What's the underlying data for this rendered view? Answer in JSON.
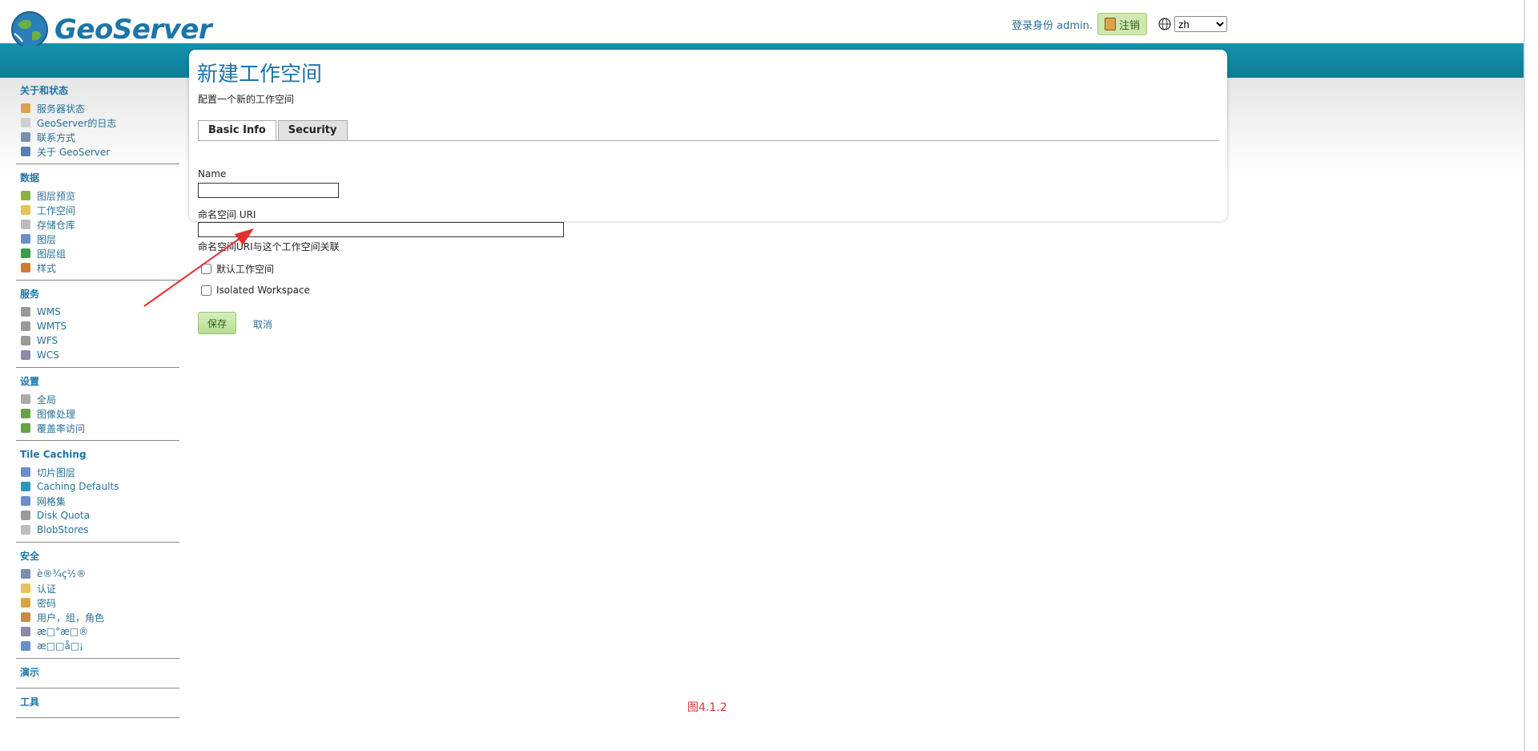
{
  "app": {
    "name": "GeoServer"
  },
  "header": {
    "login_text": "登录身份 admin.",
    "logout_label": "注销",
    "lang_value": "zh"
  },
  "sidebar": {
    "sections": [
      {
        "title": "关于和状态",
        "items": [
          {
            "label": "服务器状态",
            "icon": "server-status-icon",
            "color": "#d9a44b"
          },
          {
            "label": "GeoServer的日志",
            "icon": "log-icon",
            "color": "#cfcfcf"
          },
          {
            "label": "联系方式",
            "icon": "contact-icon",
            "color": "#7a8fb0"
          },
          {
            "label": "关于 GeoServer",
            "icon": "info-icon",
            "color": "#5b7fb0"
          }
        ]
      },
      {
        "title": "数据",
        "items": [
          {
            "label": "图层预览",
            "icon": "layer-preview-icon",
            "color": "#8ab04a"
          },
          {
            "label": "工作空间",
            "icon": "folder-icon",
            "color": "#e8c25a"
          },
          {
            "label": "存储仓库",
            "icon": "store-icon",
            "color": "#bcbcbc"
          },
          {
            "label": "图层",
            "icon": "layer-icon",
            "color": "#6a8fc8"
          },
          {
            "label": "图层组",
            "icon": "layer-group-icon",
            "color": "#3c9a4a"
          },
          {
            "label": "样式",
            "icon": "style-icon",
            "color": "#d07a3a"
          }
        ]
      },
      {
        "title": "服务",
        "items": [
          {
            "label": "WMS",
            "icon": "wms-icon",
            "color": "#9a9a9a"
          },
          {
            "label": "WMTS",
            "icon": "wmts-icon",
            "color": "#9a9a9a"
          },
          {
            "label": "WFS",
            "icon": "wfs-icon",
            "color": "#9a9a9a"
          },
          {
            "label": "WCS",
            "icon": "wcs-icon",
            "color": "#8a8aaa"
          }
        ]
      },
      {
        "title": "设置",
        "items": [
          {
            "label": "全局",
            "icon": "global-icon",
            "color": "#aaaaaa"
          },
          {
            "label": "图像处理",
            "icon": "image-processing-icon",
            "color": "#6aa04a"
          },
          {
            "label": "覆盖率访问",
            "icon": "coverage-access-icon",
            "color": "#6aa04a"
          }
        ]
      },
      {
        "title": "Tile Caching",
        "items": [
          {
            "label": "切片图层",
            "icon": "tile-layer-icon",
            "color": "#6a8fc8"
          },
          {
            "label": "Caching Defaults",
            "icon": "caching-defaults-icon",
            "color": "#2a9ab8"
          },
          {
            "label": "网格集",
            "icon": "gridset-icon",
            "color": "#6a8fc8"
          },
          {
            "label": "Disk Quota",
            "icon": "disk-quota-icon",
            "color": "#9a9a9a"
          },
          {
            "label": "BlobStores",
            "icon": "blobstore-icon",
            "color": "#bcbcbc"
          }
        ]
      },
      {
        "title": "安全",
        "items": [
          {
            "label": "è®¾ç½®",
            "icon": "settings-wrench-icon",
            "color": "#7a8fb0"
          },
          {
            "label": "认证",
            "icon": "auth-shield-icon",
            "color": "#e8c25a"
          },
          {
            "label": "密码",
            "icon": "password-lock-icon",
            "color": "#d9a44b"
          },
          {
            "label": "用户，组，角色",
            "icon": "users-icon",
            "color": "#c88a4a"
          },
          {
            "label": "æ□°æ□®",
            "icon": "data-security-icon",
            "color": "#8a8aaa"
          },
          {
            "label": "æ□□å□¡",
            "icon": "service-security-icon",
            "color": "#6a8fc8"
          }
        ]
      },
      {
        "title": "演示",
        "items": []
      },
      {
        "title": "工具",
        "items": []
      }
    ]
  },
  "main": {
    "title": "新建工作空间",
    "description": "配置一个新的工作空间",
    "tabs": [
      {
        "label": "Basic Info"
      },
      {
        "label": "Security"
      }
    ],
    "name_label": "Name",
    "uri_label": "命名空间 URI",
    "uri_help": "命名空间URI与这个工作空间关联",
    "default_ws_label": "默认工作空间",
    "isolated_ws_label": "Isolated Workspace",
    "save_label": "保存",
    "cancel_label": "取消"
  },
  "caption": "图4.1.2",
  "colors": {
    "brand_blue": "#1590ac",
    "link": "#2a6f96",
    "annotation_red": "#e23030"
  }
}
